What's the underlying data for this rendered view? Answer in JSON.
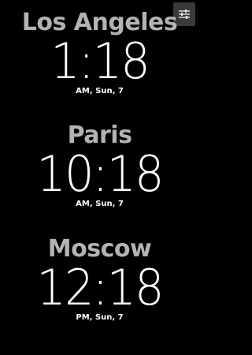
{
  "clocks": [
    {
      "city": "Los Angeles",
      "time": "1:18",
      "meta": "AM, Sun, 7"
    },
    {
      "city": "Paris",
      "time": "10:18",
      "meta": "AM, Sun, 7"
    },
    {
      "city": "Moscow",
      "time": "12:18",
      "meta": "PM, Sun, 7"
    }
  ],
  "settings": {
    "icon": "sliders-icon"
  },
  "colors": {
    "background": "#000000",
    "city_text": "#b3b3b3",
    "time_text": "#ffffff",
    "button_bg": "#3a3a3a"
  }
}
